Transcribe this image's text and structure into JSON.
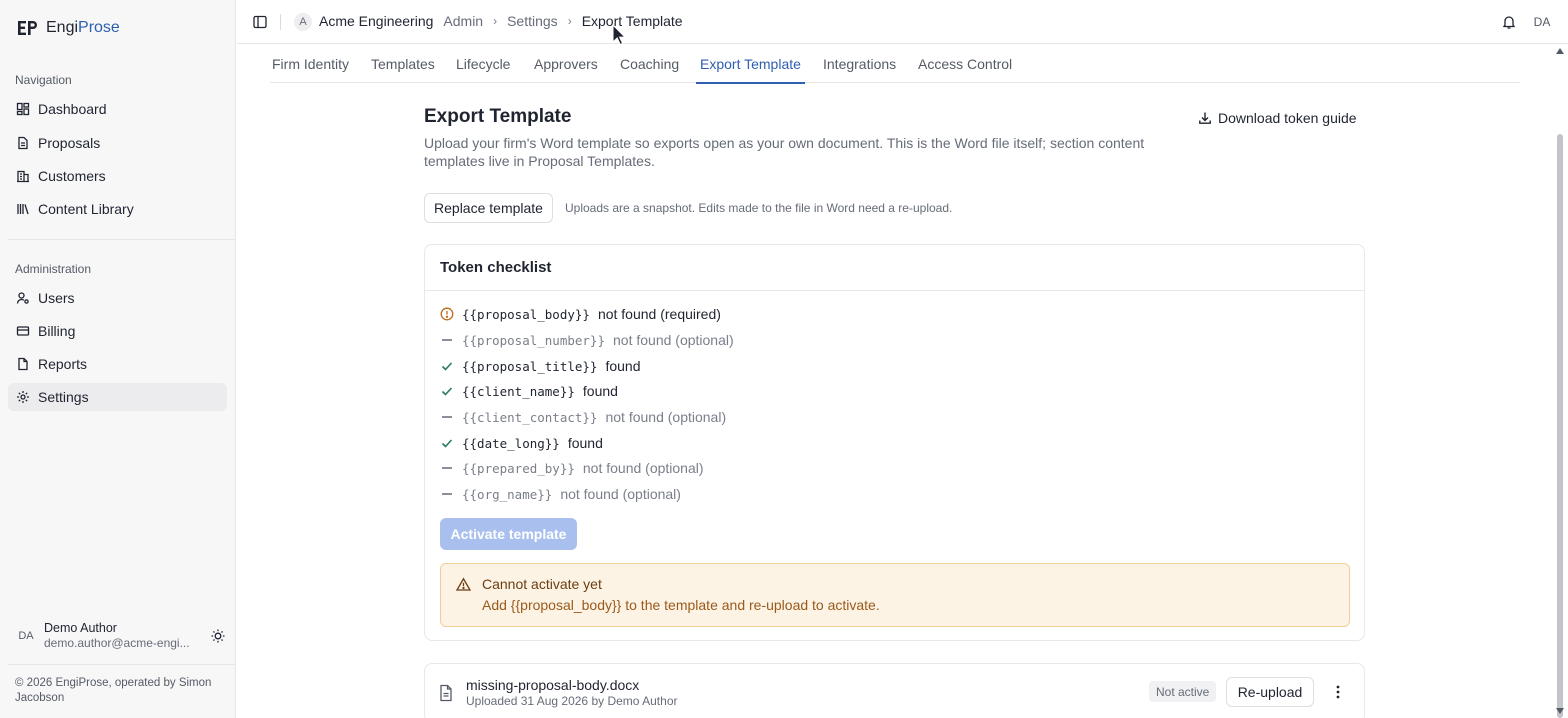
{
  "brand": {
    "name_prefix": "Engi",
    "name_suffix": "Prose"
  },
  "sidebar": {
    "navigation_label": "Navigation",
    "navigation": [
      {
        "label": "Dashboard",
        "icon": "dashboard-icon"
      },
      {
        "label": "Proposals",
        "icon": "document-icon"
      },
      {
        "label": "Customers",
        "icon": "building-icon"
      },
      {
        "label": "Content Library",
        "icon": "library-icon"
      }
    ],
    "administration_label": "Administration",
    "administration": [
      {
        "label": "Users",
        "icon": "user-cog-icon"
      },
      {
        "label": "Billing",
        "icon": "credit-card-icon"
      },
      {
        "label": "Reports",
        "icon": "report-icon"
      },
      {
        "label": "Settings",
        "icon": "gear-icon",
        "active": true
      }
    ],
    "user": {
      "initials": "DA",
      "name": "Demo Author",
      "email": "demo.author@acme-engi..."
    },
    "footer": "© 2026 EngiProse, operated by Simon Jacobson"
  },
  "topbar": {
    "org_initial": "A",
    "org_name": "Acme Engineering",
    "breadcrumbs": [
      "Admin",
      "Settings",
      "Export Template"
    ],
    "user_initials": "DA"
  },
  "tabs": [
    {
      "label": "Firm Identity"
    },
    {
      "label": "Templates"
    },
    {
      "label": "Lifecycle"
    },
    {
      "label": "Approvers"
    },
    {
      "label": "Coaching"
    },
    {
      "label": "Export Template",
      "active": true
    },
    {
      "label": "Integrations"
    },
    {
      "label": "Access Control"
    }
  ],
  "main": {
    "title": "Export Template",
    "description": "Upload your firm's Word template so exports open as your own document. This is the Word file itself; section content templates live in Proposal Templates.",
    "download_label": "Download token guide",
    "replace_label": "Replace template",
    "replace_hint": "Uploads are a snapshot. Edits made to the file in Word need a re-upload."
  },
  "checklist": {
    "title": "Token checklist",
    "tokens": [
      {
        "token": "{{proposal_body}}",
        "status": "not found (required)",
        "state": "required"
      },
      {
        "token": "{{proposal_number}}",
        "status": "not found (optional)",
        "state": "optional"
      },
      {
        "token": "{{proposal_title}}",
        "status": "found",
        "state": "found"
      },
      {
        "token": "{{client_name}}",
        "status": "found",
        "state": "found"
      },
      {
        "token": "{{client_contact}}",
        "status": "not found (optional)",
        "state": "optional"
      },
      {
        "token": "{{date_long}}",
        "status": "found",
        "state": "found"
      },
      {
        "token": "{{prepared_by}}",
        "status": "not found (optional)",
        "state": "optional"
      },
      {
        "token": "{{org_name}}",
        "status": "not found (optional)",
        "state": "optional"
      }
    ],
    "activate_label": "Activate template",
    "alert_title": "Cannot activate yet",
    "alert_body": "Add {{proposal_body}} to the template and re-upload to activate."
  },
  "file": {
    "name": "missing-proposal-body.docx",
    "meta": "Uploaded 31 Aug 2026 by Demo Author",
    "status": "Not active",
    "reupload_label": "Re-upload"
  },
  "colors": {
    "accent": "#2f5fb0",
    "warning_bg": "#fdf3e4",
    "warning_border": "#f2cf9a",
    "warning_text": "#9a5a1c",
    "required_icon": "#c06a1a",
    "found_icon": "#2a7a5a",
    "disabled_button": "#a9c0ee"
  }
}
